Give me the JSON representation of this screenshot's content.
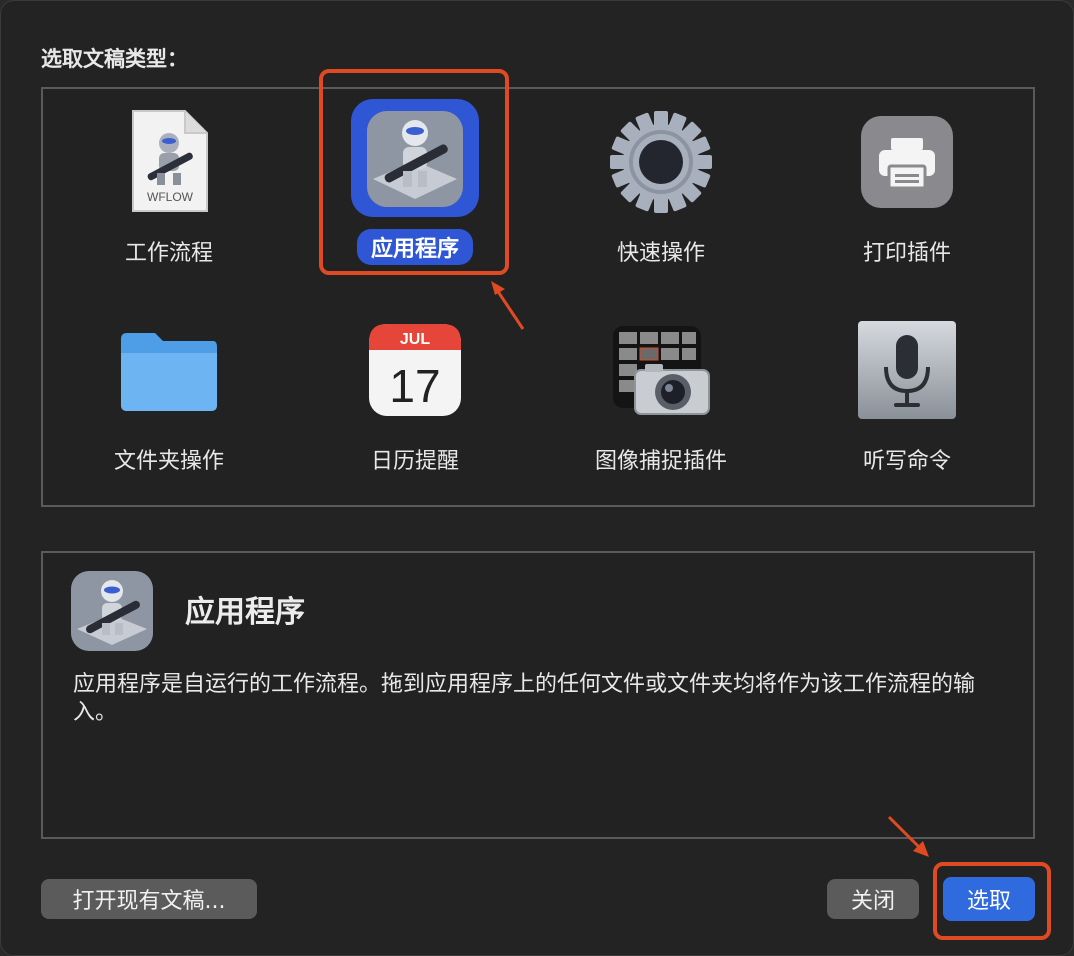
{
  "dialog": {
    "heading": "选取文稿类型：",
    "types": [
      {
        "label": "工作流程",
        "icon": "workflow-file-icon",
        "doc_text": "WFLOW"
      },
      {
        "label": "应用程序",
        "icon": "automator-app-icon",
        "selected": true
      },
      {
        "label": "快速操作",
        "icon": "gear-icon"
      },
      {
        "label": "打印插件",
        "icon": "printer-icon"
      },
      {
        "label": "文件夹操作",
        "icon": "folder-icon"
      },
      {
        "label": "日历提醒",
        "icon": "calendar-icon",
        "month": "JUL",
        "day": "17"
      },
      {
        "label": "图像捕捉插件",
        "icon": "image-capture-icon"
      },
      {
        "label": "听写命令",
        "icon": "microphone-icon"
      }
    ],
    "description": {
      "title": "应用程序",
      "text": "应用程序是自运行的工作流程。拖到应用程序上的任何文件或文件夹均将作为该工作流程的输入。"
    },
    "buttons": {
      "open_existing": "打开现有文稿...",
      "close": "关闭",
      "choose": "选取"
    }
  },
  "colors": {
    "selection": "#2f56d4",
    "primary_button": "#2f6bde",
    "annotation": "#e04a22"
  }
}
